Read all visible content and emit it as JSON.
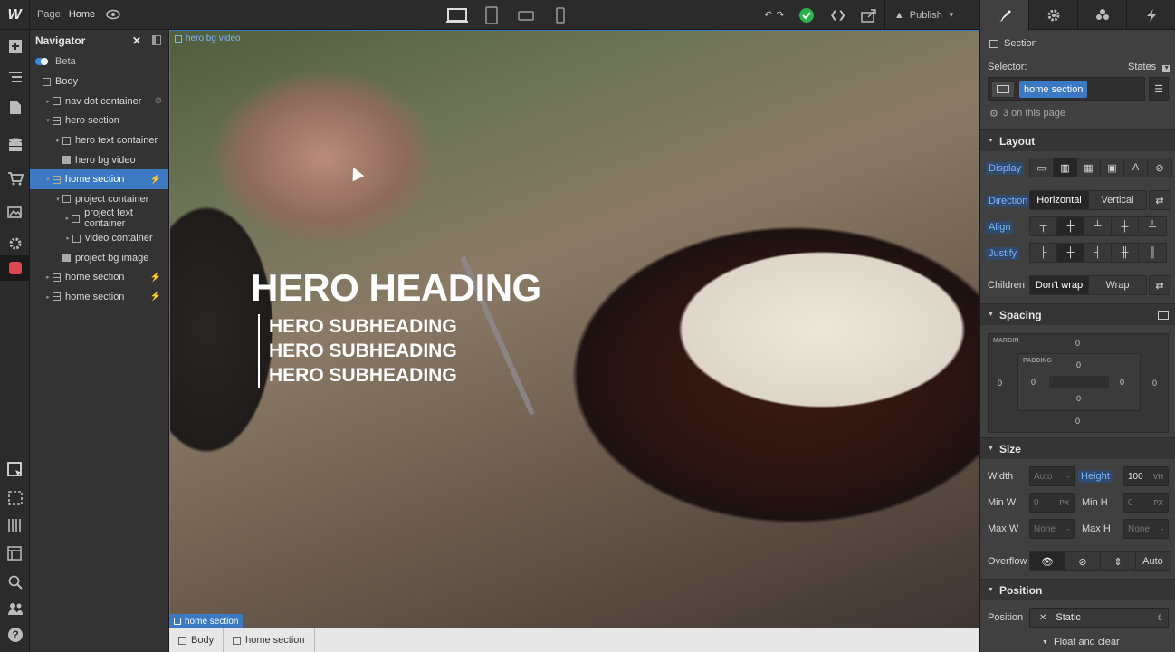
{
  "topbar": {
    "logo": "W",
    "page_label": "Page:",
    "page_name": "Home",
    "publish_label": "Publish"
  },
  "navigator": {
    "title": "Navigator",
    "beta_label": "Beta",
    "items": [
      {
        "label": "Body",
        "indent": 0,
        "arrow": "",
        "icon": "body"
      },
      {
        "label": "nav dot container",
        "indent": 1,
        "arrow": "▸",
        "icon": "box",
        "hidden": true
      },
      {
        "label": "hero section",
        "indent": 1,
        "arrow": "▾",
        "icon": "section"
      },
      {
        "label": "hero text container",
        "indent": 2,
        "arrow": "▸",
        "icon": "box"
      },
      {
        "label": "hero bg video",
        "indent": 2,
        "arrow": "",
        "icon": "video"
      },
      {
        "label": "home section",
        "indent": 1,
        "arrow": "▾",
        "icon": "section",
        "selected": true,
        "bolt": true
      },
      {
        "label": "project container",
        "indent": 2,
        "arrow": "▾",
        "icon": "box"
      },
      {
        "label": "project text container",
        "indent": 3,
        "arrow": "▸",
        "icon": "box"
      },
      {
        "label": "video container",
        "indent": 3,
        "arrow": "▸",
        "icon": "box"
      },
      {
        "label": "project bg image",
        "indent": 2,
        "arrow": "",
        "icon": "image"
      },
      {
        "label": "home section",
        "indent": 1,
        "arrow": "▸",
        "icon": "section",
        "bolt": true
      },
      {
        "label": "home section",
        "indent": 1,
        "arrow": "▸",
        "icon": "section",
        "bolt": true
      }
    ]
  },
  "canvas": {
    "element_label": "hero bg video",
    "hero_heading": "HERO HEADING",
    "subheadings": [
      "HERO SUBHEADING",
      "HERO SUBHEADING",
      "HERO SUBHEADING"
    ],
    "selected_tag": "home section"
  },
  "breadcrumb": [
    "Body",
    "home section"
  ],
  "panel": {
    "element_type": "Section",
    "selector_label": "Selector:",
    "states_label": "States",
    "selector_chip": "home section",
    "on_page": "3 on this page",
    "layout": {
      "title": "Layout",
      "display_label": "Display",
      "direction_label": "Direction",
      "direction_options": [
        "Horizontal",
        "Vertical"
      ],
      "align_label": "Align",
      "justify_label": "Justify",
      "children_label": "Children",
      "children_options": [
        "Don't wrap",
        "Wrap"
      ]
    },
    "spacing": {
      "title": "Spacing",
      "margin_caption": "MARGIN",
      "padding_caption": "PADDING",
      "margin": {
        "top": "0",
        "right": "0",
        "bottom": "0",
        "left": "0"
      },
      "padding": {
        "top": "0",
        "right": "0",
        "bottom": "0",
        "left": "0"
      }
    },
    "size": {
      "title": "Size",
      "width_label": "Width",
      "width_value": "Auto",
      "width_unit": "-",
      "height_label": "Height",
      "height_value": "100",
      "height_unit": "VH",
      "minw_label": "Min W",
      "minw_value": "0",
      "minw_unit": "PX",
      "minh_label": "Min H",
      "minh_value": "0",
      "minh_unit": "PX",
      "maxw_label": "Max W",
      "maxw_value": "None",
      "maxw_unit": "-",
      "maxh_label": "Max H",
      "maxh_value": "None",
      "maxh_unit": "-",
      "overflow_label": "Overflow",
      "overflow_auto": "Auto"
    },
    "position": {
      "title": "Position",
      "label": "Position",
      "value": "Static",
      "float_label": "Float and clear"
    }
  },
  "colors": {
    "accent": "#3b79c3",
    "panel_bg": "#404040",
    "publish_check": "#2bb24c"
  }
}
